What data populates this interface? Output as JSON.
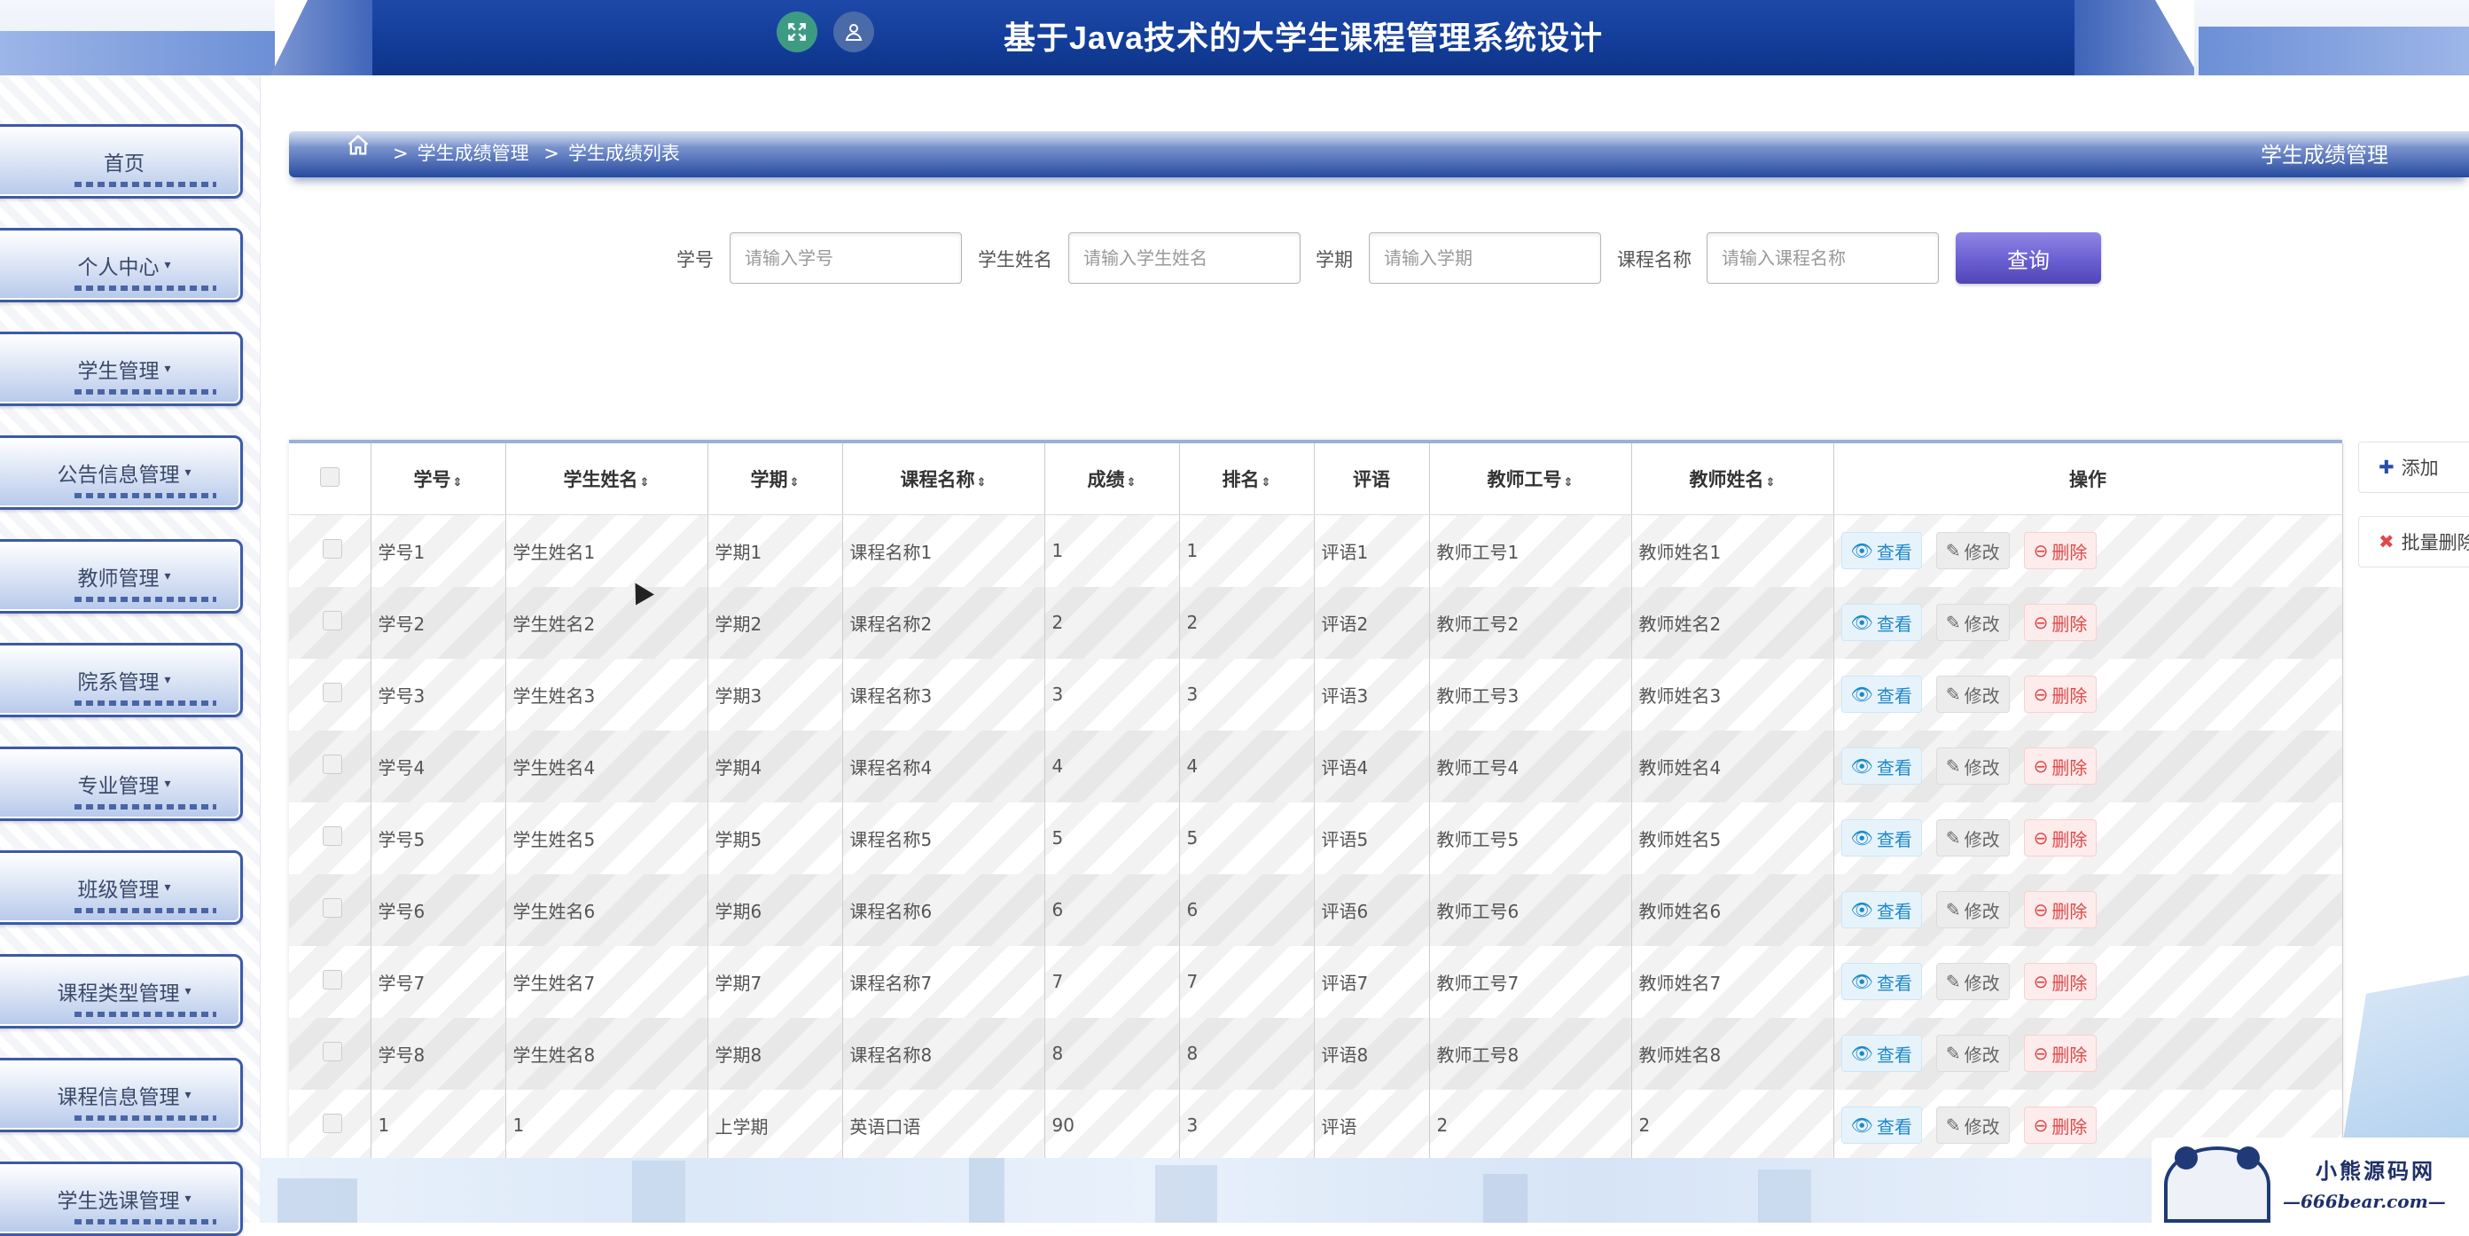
{
  "header": {
    "title": "基于Java技术的大学生课程管理系统设计",
    "fullscreen_icon": "expand-icon",
    "user_icon": "user-icon"
  },
  "sidebar": {
    "items": [
      {
        "label": "首页",
        "has_caret": false
      },
      {
        "label": "个人中心",
        "has_caret": true
      },
      {
        "label": "学生管理",
        "has_caret": true
      },
      {
        "label": "公告信息管理",
        "has_caret": true
      },
      {
        "label": "教师管理",
        "has_caret": true
      },
      {
        "label": "院系管理",
        "has_caret": true
      },
      {
        "label": "专业管理",
        "has_caret": true
      },
      {
        "label": "班级管理",
        "has_caret": true
      },
      {
        "label": "课程类型管理",
        "has_caret": true
      },
      {
        "label": "课程信息管理",
        "has_caret": true
      },
      {
        "label": "学生选课管理",
        "has_caret": true
      }
    ]
  },
  "breadcrumb": {
    "home_icon": "home-icon",
    "items": [
      "学生成绩管理",
      "学生成绩列表"
    ],
    "right_title": "学生成绩管理"
  },
  "search": {
    "fields": [
      {
        "label": "学号",
        "placeholder": "请输入学号"
      },
      {
        "label": "学生姓名",
        "placeholder": "请输入学生姓名"
      },
      {
        "label": "学期",
        "placeholder": "请输入学期"
      },
      {
        "label": "课程名称",
        "placeholder": "请输入课程名称"
      }
    ],
    "button": "查询"
  },
  "table": {
    "headers": [
      "学号",
      "学生姓名",
      "学期",
      "课程名称",
      "成绩",
      "排名",
      "评语",
      "教师工号",
      "教师姓名",
      "操作"
    ],
    "sortable": [
      true,
      true,
      true,
      true,
      true,
      true,
      false,
      true,
      true,
      false
    ],
    "rows": [
      [
        "学号1",
        "学生姓名1",
        "学期1",
        "课程名称1",
        "1",
        "1",
        "评语1",
        "教师工号1",
        "教师姓名1"
      ],
      [
        "学号2",
        "学生姓名2",
        "学期2",
        "课程名称2",
        "2",
        "2",
        "评语2",
        "教师工号2",
        "教师姓名2"
      ],
      [
        "学号3",
        "学生姓名3",
        "学期3",
        "课程名称3",
        "3",
        "3",
        "评语3",
        "教师工号3",
        "教师姓名3"
      ],
      [
        "学号4",
        "学生姓名4",
        "学期4",
        "课程名称4",
        "4",
        "4",
        "评语4",
        "教师工号4",
        "教师姓名4"
      ],
      [
        "学号5",
        "学生姓名5",
        "学期5",
        "课程名称5",
        "5",
        "5",
        "评语5",
        "教师工号5",
        "教师姓名5"
      ],
      [
        "学号6",
        "学生姓名6",
        "学期6",
        "课程名称6",
        "6",
        "6",
        "评语6",
        "教师工号6",
        "教师姓名6"
      ],
      [
        "学号7",
        "学生姓名7",
        "学期7",
        "课程名称7",
        "7",
        "7",
        "评语7",
        "教师工号7",
        "教师姓名7"
      ],
      [
        "学号8",
        "学生姓名8",
        "学期8",
        "课程名称8",
        "8",
        "8",
        "评语8",
        "教师工号8",
        "教师姓名8"
      ],
      [
        "1",
        "1",
        "上学期",
        "英语口语",
        "90",
        "3",
        "评语",
        "2",
        "2"
      ]
    ],
    "actions": {
      "view": "查看",
      "edit": "修改",
      "delete": "删除"
    }
  },
  "side_buttons": {
    "add": "添加",
    "batch_delete": "批量删除"
  },
  "watermark": {
    "cn": "小熊源码网",
    "en": "—666bear.com—"
  },
  "colors": {
    "header_blue": "#123c98",
    "query_button": "#6a5fd2",
    "view": "#1e88c8",
    "delete": "#e04848"
  }
}
